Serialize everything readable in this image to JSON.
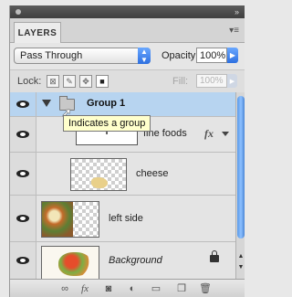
{
  "panel": {
    "tab_label": "LAYERS",
    "menu_icon": "panel-menu-icon"
  },
  "controls": {
    "blend_mode": "Pass Through",
    "opacity_label": "Opacity:",
    "opacity_value": "100%",
    "lock_label": "Lock:",
    "fill_label": "Fill:",
    "fill_value": "100%"
  },
  "layers": [
    {
      "name": "Group 1",
      "type": "group",
      "selected": true,
      "visible": true
    },
    {
      "name": "fine foods",
      "type": "text",
      "thumb_char": "T",
      "has_fx": true,
      "visible": true
    },
    {
      "name": "cheese",
      "type": "image",
      "visible": true
    },
    {
      "name": "left side",
      "type": "image",
      "visible": true
    },
    {
      "name": "Background",
      "type": "background",
      "locked": true,
      "visible": true
    }
  ],
  "tooltip": "Indicates a group",
  "fx_label": "fx",
  "bottom_tools": [
    "link-icon",
    "fx-icon",
    "mask-icon",
    "adjustment-icon",
    "new-group-icon",
    "new-layer-icon",
    "trash-icon"
  ],
  "bottom_fx": "fx",
  "colors": {
    "selection": "#b7d4f0",
    "accent": "#2d6fe0"
  }
}
